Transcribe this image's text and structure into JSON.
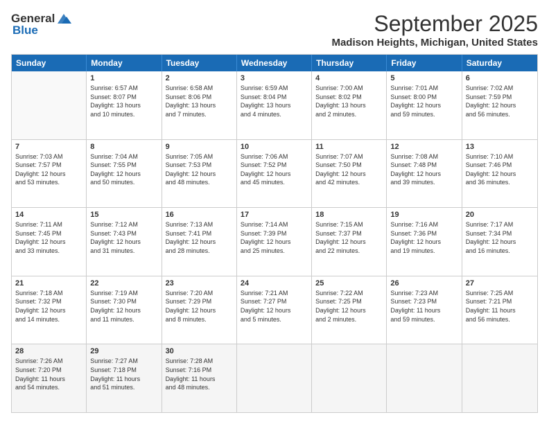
{
  "header": {
    "logo_general": "General",
    "logo_blue": "Blue",
    "month_title": "September 2025",
    "location": "Madison Heights, Michigan, United States"
  },
  "calendar": {
    "days_of_week": [
      "Sunday",
      "Monday",
      "Tuesday",
      "Wednesday",
      "Thursday",
      "Friday",
      "Saturday"
    ],
    "rows": [
      [
        {
          "day": "",
          "info": ""
        },
        {
          "day": "1",
          "info": "Sunrise: 6:57 AM\nSunset: 8:07 PM\nDaylight: 13 hours\nand 10 minutes."
        },
        {
          "day": "2",
          "info": "Sunrise: 6:58 AM\nSunset: 8:06 PM\nDaylight: 13 hours\nand 7 minutes."
        },
        {
          "day": "3",
          "info": "Sunrise: 6:59 AM\nSunset: 8:04 PM\nDaylight: 13 hours\nand 4 minutes."
        },
        {
          "day": "4",
          "info": "Sunrise: 7:00 AM\nSunset: 8:02 PM\nDaylight: 13 hours\nand 2 minutes."
        },
        {
          "day": "5",
          "info": "Sunrise: 7:01 AM\nSunset: 8:00 PM\nDaylight: 12 hours\nand 59 minutes."
        },
        {
          "day": "6",
          "info": "Sunrise: 7:02 AM\nSunset: 7:59 PM\nDaylight: 12 hours\nand 56 minutes."
        }
      ],
      [
        {
          "day": "7",
          "info": "Sunrise: 7:03 AM\nSunset: 7:57 PM\nDaylight: 12 hours\nand 53 minutes."
        },
        {
          "day": "8",
          "info": "Sunrise: 7:04 AM\nSunset: 7:55 PM\nDaylight: 12 hours\nand 50 minutes."
        },
        {
          "day": "9",
          "info": "Sunrise: 7:05 AM\nSunset: 7:53 PM\nDaylight: 12 hours\nand 48 minutes."
        },
        {
          "day": "10",
          "info": "Sunrise: 7:06 AM\nSunset: 7:52 PM\nDaylight: 12 hours\nand 45 minutes."
        },
        {
          "day": "11",
          "info": "Sunrise: 7:07 AM\nSunset: 7:50 PM\nDaylight: 12 hours\nand 42 minutes."
        },
        {
          "day": "12",
          "info": "Sunrise: 7:08 AM\nSunset: 7:48 PM\nDaylight: 12 hours\nand 39 minutes."
        },
        {
          "day": "13",
          "info": "Sunrise: 7:10 AM\nSunset: 7:46 PM\nDaylight: 12 hours\nand 36 minutes."
        }
      ],
      [
        {
          "day": "14",
          "info": "Sunrise: 7:11 AM\nSunset: 7:45 PM\nDaylight: 12 hours\nand 33 minutes."
        },
        {
          "day": "15",
          "info": "Sunrise: 7:12 AM\nSunset: 7:43 PM\nDaylight: 12 hours\nand 31 minutes."
        },
        {
          "day": "16",
          "info": "Sunrise: 7:13 AM\nSunset: 7:41 PM\nDaylight: 12 hours\nand 28 minutes."
        },
        {
          "day": "17",
          "info": "Sunrise: 7:14 AM\nSunset: 7:39 PM\nDaylight: 12 hours\nand 25 minutes."
        },
        {
          "day": "18",
          "info": "Sunrise: 7:15 AM\nSunset: 7:37 PM\nDaylight: 12 hours\nand 22 minutes."
        },
        {
          "day": "19",
          "info": "Sunrise: 7:16 AM\nSunset: 7:36 PM\nDaylight: 12 hours\nand 19 minutes."
        },
        {
          "day": "20",
          "info": "Sunrise: 7:17 AM\nSunset: 7:34 PM\nDaylight: 12 hours\nand 16 minutes."
        }
      ],
      [
        {
          "day": "21",
          "info": "Sunrise: 7:18 AM\nSunset: 7:32 PM\nDaylight: 12 hours\nand 14 minutes."
        },
        {
          "day": "22",
          "info": "Sunrise: 7:19 AM\nSunset: 7:30 PM\nDaylight: 12 hours\nand 11 minutes."
        },
        {
          "day": "23",
          "info": "Sunrise: 7:20 AM\nSunset: 7:29 PM\nDaylight: 12 hours\nand 8 minutes."
        },
        {
          "day": "24",
          "info": "Sunrise: 7:21 AM\nSunset: 7:27 PM\nDaylight: 12 hours\nand 5 minutes."
        },
        {
          "day": "25",
          "info": "Sunrise: 7:22 AM\nSunset: 7:25 PM\nDaylight: 12 hours\nand 2 minutes."
        },
        {
          "day": "26",
          "info": "Sunrise: 7:23 AM\nSunset: 7:23 PM\nDaylight: 11 hours\nand 59 minutes."
        },
        {
          "day": "27",
          "info": "Sunrise: 7:25 AM\nSunset: 7:21 PM\nDaylight: 11 hours\nand 56 minutes."
        }
      ],
      [
        {
          "day": "28",
          "info": "Sunrise: 7:26 AM\nSunset: 7:20 PM\nDaylight: 11 hours\nand 54 minutes."
        },
        {
          "day": "29",
          "info": "Sunrise: 7:27 AM\nSunset: 7:18 PM\nDaylight: 11 hours\nand 51 minutes."
        },
        {
          "day": "30",
          "info": "Sunrise: 7:28 AM\nSunset: 7:16 PM\nDaylight: 11 hours\nand 48 minutes."
        },
        {
          "day": "",
          "info": ""
        },
        {
          "day": "",
          "info": ""
        },
        {
          "day": "",
          "info": ""
        },
        {
          "day": "",
          "info": ""
        }
      ]
    ]
  }
}
